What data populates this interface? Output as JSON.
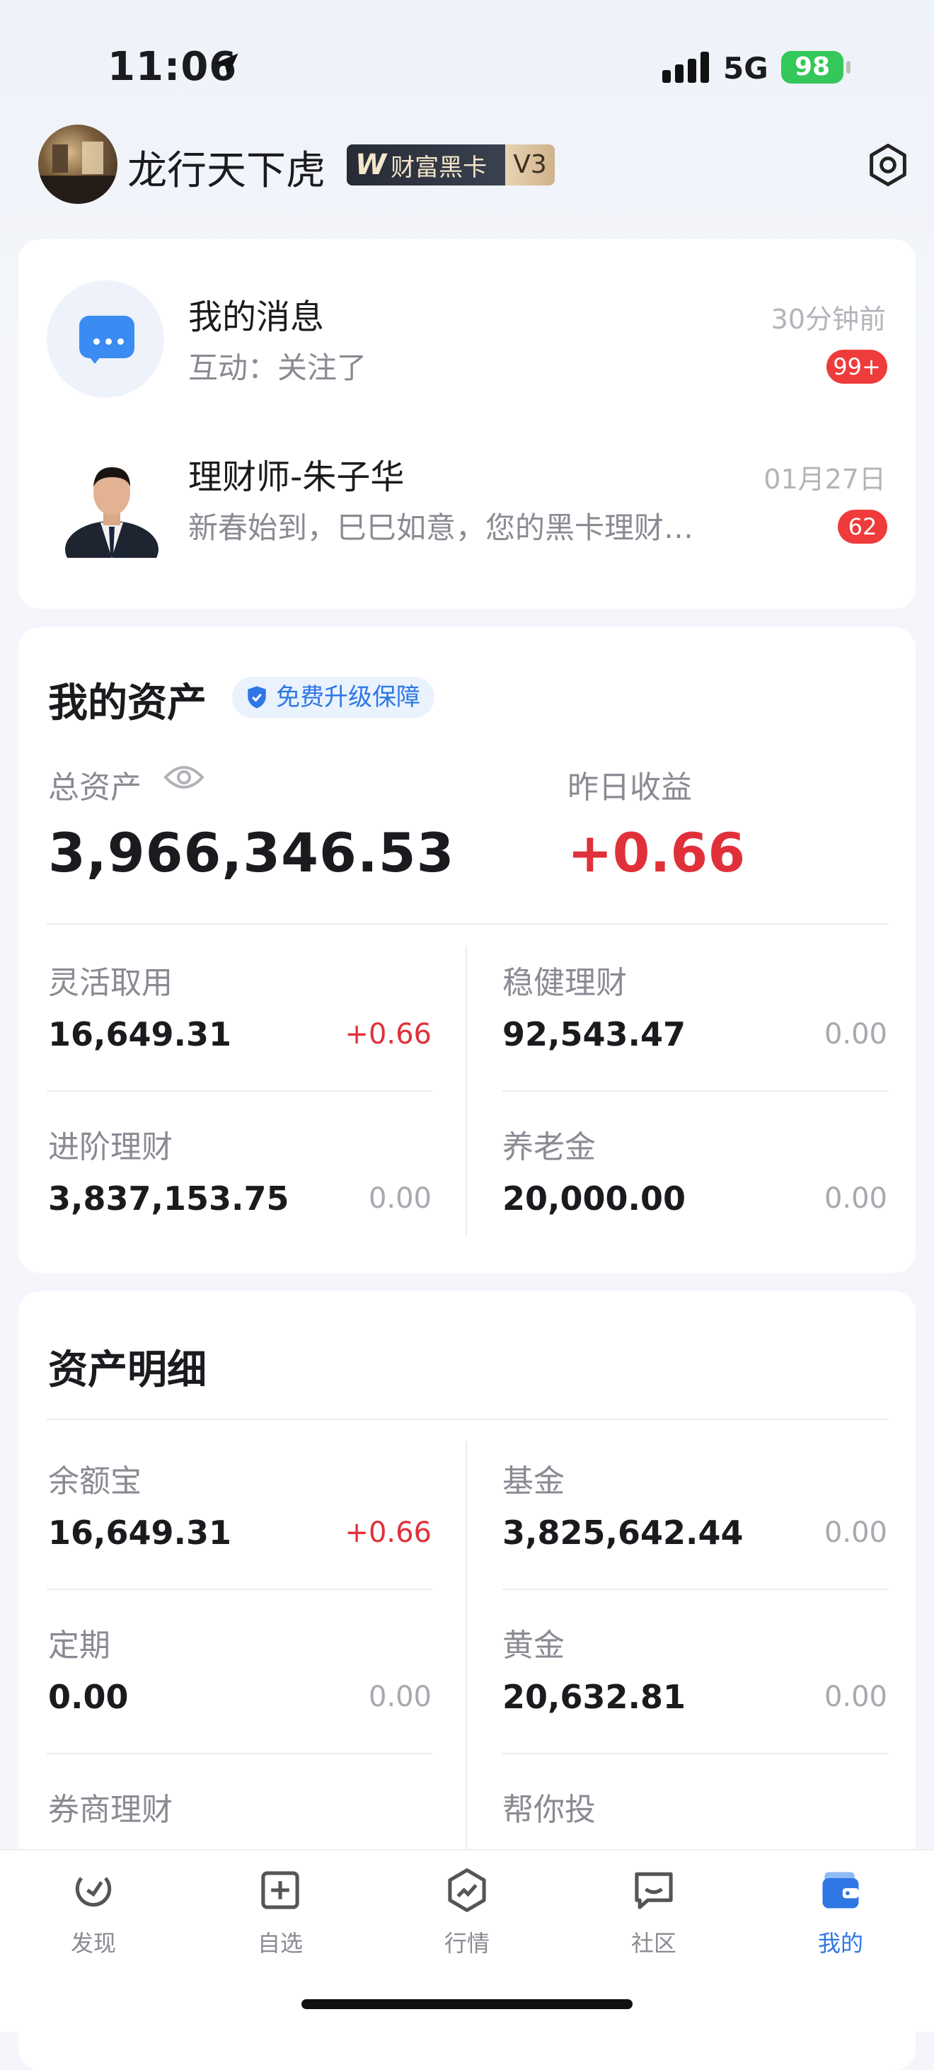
{
  "status_bar": {
    "time": "11:06",
    "network": "5G",
    "battery": "98"
  },
  "profile": {
    "username": "龙行天下虎",
    "badge_text": "财富黑卡",
    "badge_level": "V3"
  },
  "messages": [
    {
      "title": "我的消息",
      "subtitle": "互动：关注了",
      "time": "30分钟前",
      "badge": "99+"
    },
    {
      "title": "理财师-朱子华",
      "subtitle": "新春始到，巳巳如意，您的黑卡理财…",
      "time": "01月27日",
      "badge": "62"
    }
  ],
  "assets": {
    "title": "我的资产",
    "upgrade_tag": "免费升级保障",
    "total_label": "总资产",
    "total_value": "3,966,346.53",
    "yield_label": "昨日收益",
    "yield_value": "+0.66",
    "items": [
      {
        "label": "灵活取用",
        "value": "16,649.31",
        "change": "+0.66"
      },
      {
        "label": "稳健理财",
        "value": "92,543.47",
        "change": "0.00"
      },
      {
        "label": "进阶理财",
        "value": "3,837,153.75",
        "change": "0.00"
      },
      {
        "label": "养老金",
        "value": "20,000.00",
        "change": "0.00"
      }
    ]
  },
  "details": {
    "title": "资产明细",
    "items": [
      {
        "label": "余额宝",
        "value": "16,649.31",
        "change": "+0.66"
      },
      {
        "label": "基金",
        "value": "3,825,642.44",
        "change": "0.00"
      },
      {
        "label": "定期",
        "value": "0.00",
        "change": "0.00"
      },
      {
        "label": "黄金",
        "value": "20,632.81",
        "change": "0.00"
      },
      {
        "label": "券商理财"
      },
      {
        "label": "帮你投"
      }
    ]
  },
  "tabbar": [
    {
      "label": "发现",
      "icon": "discover-icon"
    },
    {
      "label": "自选",
      "icon": "watchlist-icon"
    },
    {
      "label": "行情",
      "icon": "market-icon"
    },
    {
      "label": "社区",
      "icon": "community-icon"
    },
    {
      "label": "我的",
      "icon": "wallet-icon",
      "active": true
    }
  ],
  "colors": {
    "accent": "#2e77e5",
    "positive": "#e0313a",
    "badge": "#ef3b3b"
  }
}
